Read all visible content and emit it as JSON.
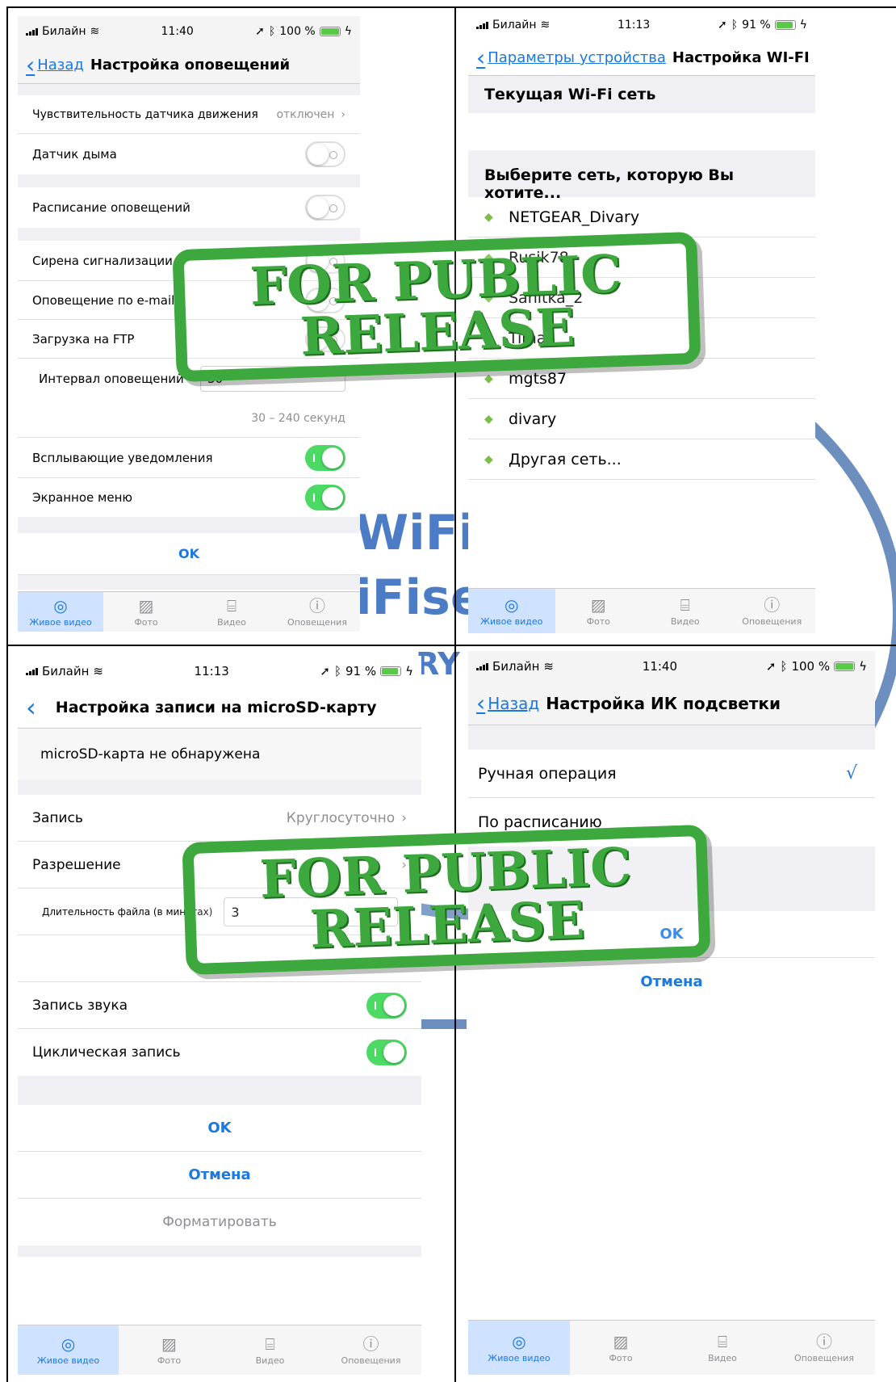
{
  "q1": {
    "status": {
      "carrier": "Билайн",
      "time": "11:40",
      "battery": "100 %",
      "battery_level": 1.0
    },
    "nav": {
      "back": "Назад",
      "title": "Настройка оповещений"
    },
    "rows": [
      {
        "label": "Чувствительность датчика движения",
        "value": "отключен"
      },
      {
        "label": "Датчик дыма"
      },
      {
        "label": "Расписание оповещений"
      },
      {
        "label": "Сирена сигнализации"
      },
      {
        "label": "Оповещение по e-mail"
      },
      {
        "label": "Загрузка на FTP"
      },
      {
        "label": "Интервал оповещений"
      },
      {
        "label": "30 – 240 секунд"
      },
      {
        "label": "Всплывающие  уведомления"
      },
      {
        "label": "Экранное меню"
      }
    ],
    "interval_value": "30",
    "ok": "OK",
    "tabs": [
      "Живое видео",
      "Фото",
      "Видео",
      "Оповещения"
    ]
  },
  "q2": {
    "status": {
      "carrier": "Билайн",
      "time": "11:13",
      "battery": "91 %",
      "battery_level": 0.91
    },
    "nav": {
      "back": "Параметры устройства",
      "title": "Настройка WI-FI"
    },
    "current_header": "Текущая Wi-Fi сеть",
    "choose_header": "Выберите сеть, которую Вы хотите...",
    "networks": [
      "NETGEAR_Divary",
      "Rusik78",
      "Sanitka_2",
      "Tima",
      "mgts87",
      "divary",
      "Другая сеть..."
    ],
    "tabs": [
      "Живое видео",
      "Фото",
      "Видео",
      "Оповещения"
    ]
  },
  "q3": {
    "status": {
      "carrier": "Билайн",
      "time": "11:13",
      "battery": "91 %",
      "battery_level": 0.91
    },
    "nav": {
      "title": "Настройка записи на microSD-карту"
    },
    "sd_status": "microSD-карта не обнаружена",
    "rows": {
      "record": "Запись",
      "record_value": "Круглосуточно",
      "resolution": "Разрешение",
      "duration": "Длительность файла (в минутах)",
      "duration_value": "3",
      "audio": "Запись звука",
      "loop": "Циклическая запись"
    },
    "ok": "OK",
    "cancel": "Отмена",
    "format": "Форматировать",
    "tabs": [
      "Живое видео",
      "Фото",
      "Видео",
      "Оповещения"
    ]
  },
  "q4": {
    "status": {
      "carrier": "Билайн",
      "time": "11:40",
      "battery": "100 %",
      "battery_level": 1.0
    },
    "nav": {
      "back": "Назад",
      "title": "Настройка ИК подсветки"
    },
    "manual": "Ручная операция",
    "check": "√",
    "schedule": "По расписанию",
    "ok": "OK",
    "cancel": "Отмена",
    "tabs": [
      "Живое видео",
      "Фото",
      "Видео",
      "Оповещения"
    ]
  },
  "stamp": {
    "line1": "FOR PUBLIC",
    "line2": "RELEASE"
  },
  "watermark": {
    "w1": "WiFi",
    "w2": "iFise",
    "w3": "RY"
  },
  "colors": {
    "ios_blue": "#1a78e0",
    "toggle_on": "#4cd964",
    "stamp_green": "#3da83d",
    "wifi_green": "#7ac143",
    "tab_active_bg": "#cfe2ff"
  }
}
